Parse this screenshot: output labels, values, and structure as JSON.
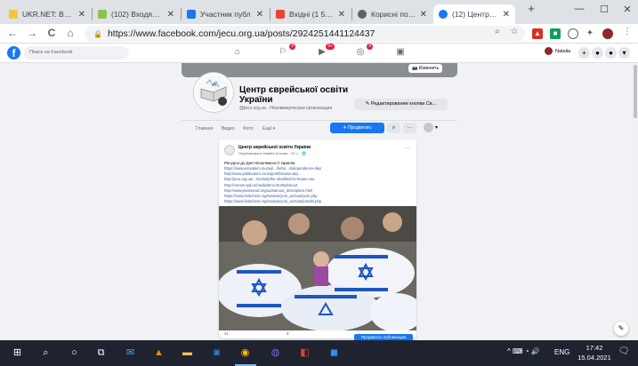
{
  "browser": {
    "tabs": [
      {
        "title": "UKR.NET: Всі но",
        "favicon_color": "#f4c542",
        "active": false
      },
      {
        "title": "(102) Входящие",
        "favicon_color": "#8bc34a",
        "active": false
      },
      {
        "title": "Участник публ",
        "favicon_color": "#1877f2",
        "active": false
      },
      {
        "title": "Вхідні (1 569)",
        "favicon_color": "#ea4335",
        "active": false
      },
      {
        "title": "Корисні посил",
        "favicon_color": "#5f6368",
        "active": false
      },
      {
        "title": "(12) Центр евр",
        "favicon_color": "#1877f2",
        "active": true
      }
    ],
    "new_tab_label": "+",
    "window_buttons": {
      "minimize": "—",
      "maximize": "☐",
      "close": "✕"
    },
    "url": "https://www.facebook.com/jecu.org.ua/posts/2924251441124437",
    "nav": {
      "back": "←",
      "forward": "→",
      "reload": "C",
      "home": "⌂"
    }
  },
  "facebook": {
    "logo": "f",
    "search_placeholder": "Поиск на Facebook",
    "nav_badges": {
      "pages": "9",
      "watch": "9+",
      "groups": "9"
    },
    "user_name": "Natalia"
  },
  "page": {
    "edit_cover_label": "Изменить",
    "name": "Центр єврейської освіти України",
    "subtitle": "@jecu.org.ua · Некоммерческая организация",
    "edit_button_label": "Редактирование кнопки Св...",
    "tabs": [
      "Главная",
      "Видео",
      "Фото",
      "Ещё ▾"
    ],
    "promote_label": "Продвигать",
    "search_icon": "search-icon",
    "more_label": "···"
  },
  "post": {
    "author": "Центр єврейської освіти України",
    "meta": "Опубликовано Natalia Ильева · 23 ч. · 🌐",
    "more": "···",
    "title": "Ресурси до Дня Незалежності Ізраїлю:",
    "links": [
      "https://www.jerusalem.muzeji/.../hebu.../independence-day/",
      "http://www.publicators.com/sport/browse.asp...",
      "http://jecu.org.ua/.../melody/the-ideal/leaf-to-house.nao",
      "http://mnoot.npd.ru/media/tens.htm#jahmout",
      "http://www.jewisnews.org/ua/samout_description.html",
      "https://www.lookchein.org/russian/yom_acmaut/yom.php",
      "https://www.lookchein.org/russian/yom_acmaut/jomaht.php"
    ],
    "footer_left": "21",
    "footer_mid": "9",
    "promote_post_label": "Продвигать публикацию"
  },
  "taskbar": {
    "apps": [
      "start-icon",
      "search-icon",
      "cortana-icon",
      "task-view-icon",
      "mail-icon",
      "vlc-icon",
      "explorer-icon",
      "outlook-icon",
      "chrome-icon",
      "viber-icon",
      "powerpoint-icon",
      "zoom-icon"
    ],
    "tray_icons": "^  ⌨  ◔  🔊",
    "language": "ENG",
    "time": "17:42",
    "date": "15.04.2021"
  }
}
